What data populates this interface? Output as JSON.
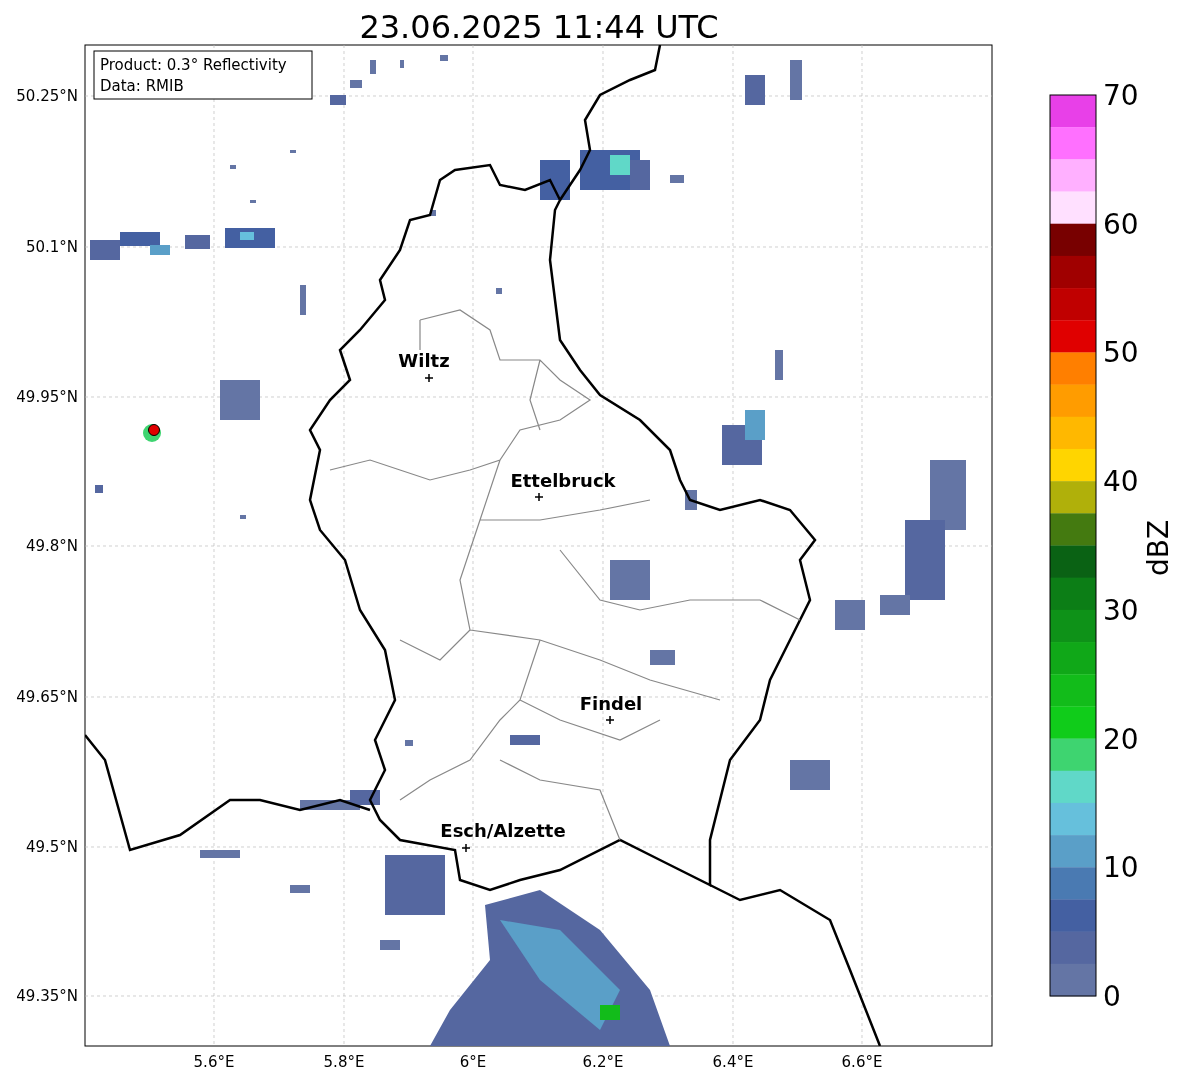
{
  "title": "23.06.2025 11:44 UTC",
  "info_box": {
    "lines": [
      "Product: 0.3° Reflectivity",
      "Data: RMIB"
    ]
  },
  "map": {
    "lat_ticks": [
      "50.25°N",
      "50.1°N",
      "49.95°N",
      "49.8°N",
      "49.65°N",
      "49.5°N",
      "49.35°N"
    ],
    "lon_ticks": [
      "5.6°E",
      "5.8°E",
      "6°E",
      "6.2°E",
      "6.4°E",
      "6.6°E"
    ],
    "cities": [
      {
        "name": "Wiltz"
      },
      {
        "name": "Ettelbruck"
      },
      {
        "name": "Findel"
      },
      {
        "name": "Esch/Alzette"
      }
    ]
  },
  "colorbar": {
    "label": "dBZ",
    "ticks": [
      "70",
      "60",
      "50",
      "40",
      "30",
      "20",
      "10",
      "0"
    ],
    "bins": [
      {
        "color": "#e840e8"
      },
      {
        "color": "#ff70ff"
      },
      {
        "color": "#ffb0ff"
      },
      {
        "color": "#ffe0ff"
      },
      {
        "color": "#780000"
      },
      {
        "color": "#a00000"
      },
      {
        "color": "#c00000"
      },
      {
        "color": "#e00000"
      },
      {
        "color": "#ff7f00"
      },
      {
        "color": "#ff9c00"
      },
      {
        "color": "#ffb800"
      },
      {
        "color": "#ffd500"
      },
      {
        "color": "#b0b00a"
      },
      {
        "color": "#447a10"
      },
      {
        "color": "#0a6214"
      },
      {
        "color": "#0c7e16"
      },
      {
        "color": "#0e9218"
      },
      {
        "color": "#10a818"
      },
      {
        "color": "#12bc1a"
      },
      {
        "color": "#10cc1a"
      },
      {
        "color": "#3ed470"
      },
      {
        "color": "#60d8c8"
      },
      {
        "color": "#66c0dc"
      },
      {
        "color": "#5a9fc8"
      },
      {
        "color": "#4a7ab2"
      },
      {
        "color": "#4460a2"
      },
      {
        "color": "#5567a0"
      },
      {
        "color": "#6475a5"
      }
    ]
  }
}
